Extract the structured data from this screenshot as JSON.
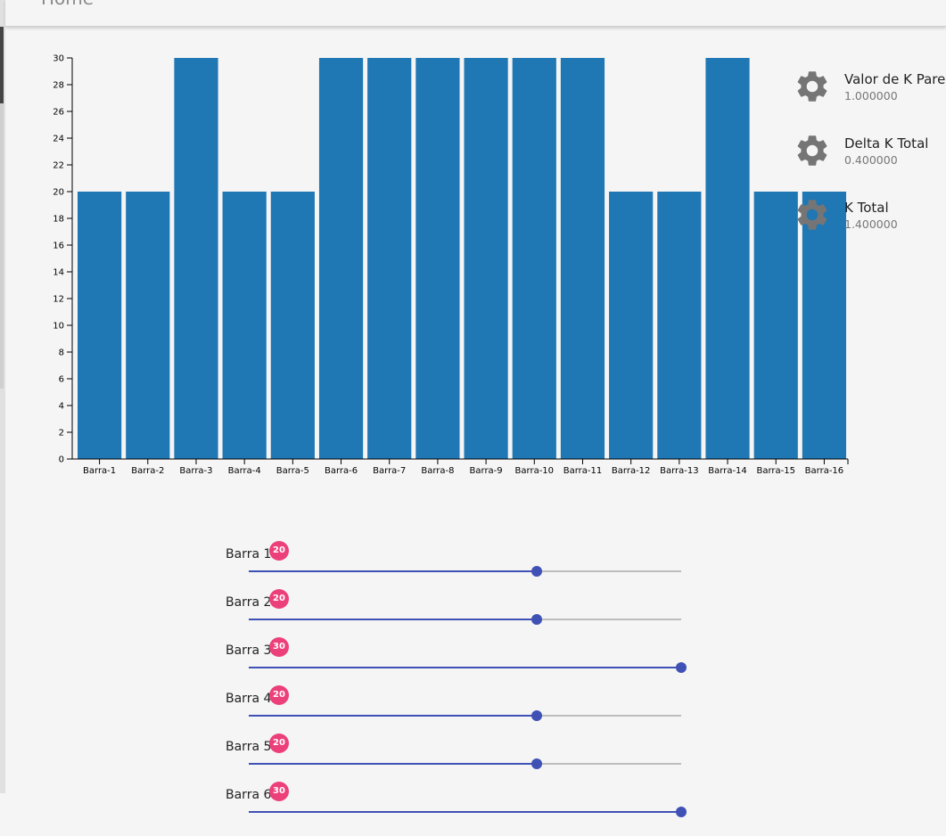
{
  "appbar": {
    "title": "Home"
  },
  "chart_data": {
    "type": "bar",
    "categories": [
      "Barra-1",
      "Barra-2",
      "Barra-3",
      "Barra-4",
      "Barra-5",
      "Barra-6",
      "Barra-7",
      "Barra-8",
      "Barra-9",
      "Barra-10",
      "Barra-11",
      "Barra-12",
      "Barra-13",
      "Barra-14",
      "Barra-15",
      "Barra-16"
    ],
    "values": [
      20,
      20,
      30,
      20,
      20,
      30,
      30,
      30,
      30,
      30,
      30,
      20,
      20,
      30,
      20,
      20
    ],
    "ylim": [
      0,
      30
    ],
    "yticks": [
      0,
      2,
      4,
      6,
      8,
      10,
      12,
      14,
      16,
      18,
      20,
      22,
      24,
      26,
      28,
      30
    ],
    "bar_color": "#1f77b4",
    "grid": false
  },
  "info_panel": [
    {
      "label": "Valor de K Parede",
      "value": "1.000000",
      "icon": "gear-icon"
    },
    {
      "label": "Delta K Total",
      "value": "0.400000",
      "icon": "gear-icon"
    },
    {
      "label": "K Total",
      "value": "1.400000",
      "icon": "gear-icon"
    }
  ],
  "sliders": {
    "min": 0,
    "max": 30,
    "items": [
      {
        "label": "Barra 1",
        "value": 20,
        "badge": "20"
      },
      {
        "label": "Barra 2",
        "value": 20,
        "badge": "20"
      },
      {
        "label": "Barra 3",
        "value": 30,
        "badge": "30"
      },
      {
        "label": "Barra 4",
        "value": 20,
        "badge": "20"
      },
      {
        "label": "Barra 5",
        "value": 20,
        "badge": "20"
      },
      {
        "label": "Barra 6",
        "value": 30,
        "badge": "30"
      }
    ]
  },
  "colors": {
    "accent": "#3f51b5",
    "badge": "#ec407a",
    "icon": "#757575"
  }
}
